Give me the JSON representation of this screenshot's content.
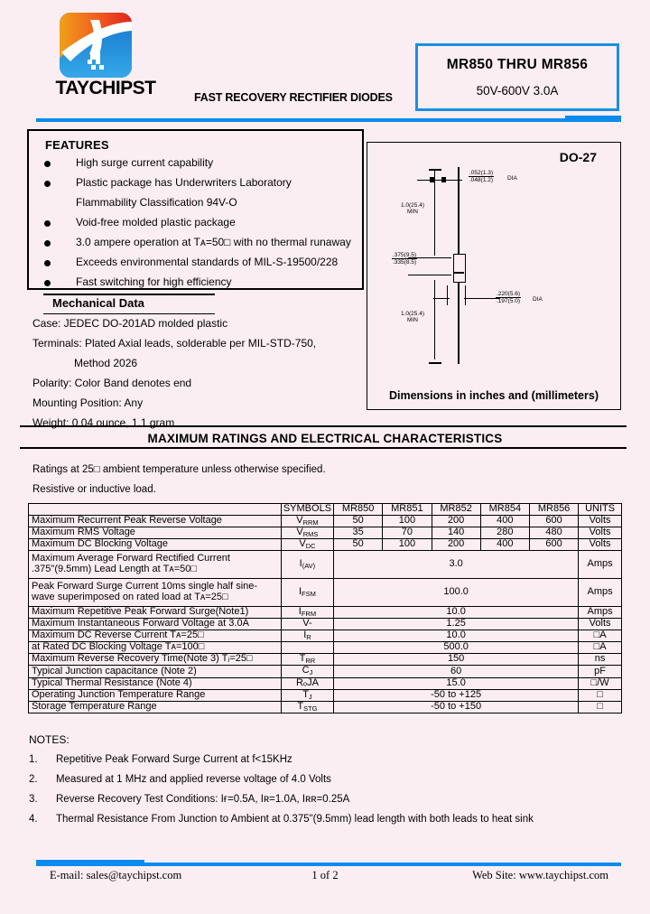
{
  "header": {
    "company": "TAYCHIPST",
    "tagline": "FAST RECOVERY RECTIFIER DIODES",
    "part_range": "MR850  THRU  MR856",
    "ratings_summary": "50V-600V    3.0A"
  },
  "features": {
    "title": "FEATURES",
    "items": [
      "High surge current capability",
      "Plastic package has Underwriters Laboratory",
      "Flammability Classification 94V-O",
      "Void-free molded plastic package",
      "3.0 ampere operation at Tᴀ=50□ with no thermal runaway",
      "Exceeds environmental standards of MIL-S-19500/228",
      "Fast switching for high efficiency"
    ]
  },
  "mechanical": {
    "title": "Mechanical Data",
    "lines": [
      "Case: JEDEC DO-201AD molded plastic",
      "Terminals: Plated Axial leads, solderable per MIL-STD-750,",
      "Method 2026",
      "Polarity: Color Band denotes end",
      "Mounting Position: Any",
      "Weight: 0.04 ounce, 1.1 gram"
    ]
  },
  "diagram": {
    "package": "DO-27",
    "caption": "Dimensions in inches and (millimeters)",
    "lead_dia_top_num": ".052(1.3)",
    "lead_dia_top_den": ".048(1.2)",
    "lead_dia_top_label": "DIA",
    "length_top_value": "1.0(25.4)",
    "length_top_min": "MIN",
    "body_len_num": ".375(9.5)",
    "body_len_den": ".335(8.5)",
    "body_dia_num": ".220(5.6)",
    "body_dia_den": ".197(5.0)",
    "body_dia_label": "DIA",
    "length_bot_value": "1.0(25.4)",
    "length_bot_min": "MIN"
  },
  "section": {
    "title": "MAXIMUM RATINGS AND ELECTRICAL CHARACTERISTICS",
    "note_ratings": "Ratings at 25□ ambient temperature unless otherwise specified.",
    "note_load": "Resistive or inductive load."
  },
  "table": {
    "headers": [
      "",
      "SYMBOLS",
      "MR850",
      "MR851",
      "MR852",
      "MR854",
      "MR856",
      "UNITS"
    ],
    "rows": [
      {
        "desc": "Maximum Recurrent Peak Reverse Voltage",
        "sym": "V",
        "sub": "RRM",
        "values": [
          "50",
          "100",
          "200",
          "400",
          "600"
        ],
        "unit": "Volts"
      },
      {
        "desc": "Maximum RMS Voltage",
        "sym": "V",
        "sub": "RMS",
        "values": [
          "35",
          "70",
          "140",
          "280",
          "480"
        ],
        "unit": "Volts"
      },
      {
        "desc": "Maximum DC Blocking Voltage",
        "sym": "V",
        "sub": "DC",
        "values": [
          "50",
          "100",
          "200",
          "400",
          "600"
        ],
        "unit": "Volts"
      },
      {
        "desc": "Maximum Average Forward Rectified Current",
        "desc2": ".375\"(9.5mm) Lead Length at Tᴀ=50□",
        "sym": "I",
        "sub": "(AV)",
        "span": "3.0",
        "unit": "Amps"
      },
      {
        "desc": "Peak Forward Surge Current 10ms single half sine-",
        "desc2": "wave superimposed on rated load at Tᴀ=25□",
        "sym": "I",
        "sub": "FSM",
        "span": "100.0",
        "unit": "Amps"
      },
      {
        "desc": "Maximum Repetitive Peak Forward Surge(Note1)",
        "sym": "I",
        "sub": "FRM",
        "span": "10.0",
        "unit": "Amps"
      },
      {
        "desc": "Maximum Instantaneous Forward Voltage at 3.0A",
        "sym": "V-",
        "sub": "",
        "span": "1.25",
        "unit": "Volts"
      },
      {
        "desc": "Maximum DC Reverse Current  Tᴀ=25□",
        "sym": "I",
        "sub": "R",
        "span": "10.0",
        "unit": "□A"
      },
      {
        "desc": "at Rated DC Blocking Voltage Tᴀ=100□",
        "sym": "",
        "sub": "",
        "span": "500.0",
        "unit": "□A"
      },
      {
        "desc": "Maximum Reverse Recovery Time(Note 3) Tⱼ=25□",
        "sym": "T",
        "sub": "RR",
        "span": "150",
        "unit": "ns"
      },
      {
        "desc": "Typical Junction capacitance (Note 2)",
        "sym": "C",
        "sub": "J",
        "span": "60",
        "unit": "pF"
      },
      {
        "desc": "Typical Thermal Resistance (Note 4)",
        "sym": "RₒJA",
        "sub": "",
        "span": "15.0",
        "unit": "□/W"
      },
      {
        "desc": "Operating Junction Temperature Range",
        "sym": "T",
        "sub": "J",
        "span": "-50 to +125",
        "unit": "□"
      },
      {
        "desc": "Storage Temperature Range",
        "sym": "T",
        "sub": "STG",
        "span": "-50 to +150",
        "unit": "□"
      }
    ]
  },
  "notes": {
    "title": "NOTES:",
    "items": [
      {
        "num": "1.",
        "text": "Repetitive Peak Forward Surge Current at f<15KHz"
      },
      {
        "num": "2.",
        "text": "Measured at 1 MHz and applied reverse voltage of 4.0 Volts"
      },
      {
        "num": "3.",
        "text": "Reverse Recovery Test Conditions: Iғ=0.5A, Iʀ=1.0A, Iʀʀ=0.25A"
      },
      {
        "num": "4.",
        "text": "Thermal Resistance From Junction to Ambient at 0.375\"(9.5mm) lead length with both leads to heat sink"
      }
    ]
  },
  "footer": {
    "email": "E-mail: sales@taychipst.com",
    "page": "1  of  2",
    "website": "Web Site: www.taychipst.com"
  },
  "colors": {
    "background": "#fbeef3",
    "accent_blue": "#0b8bec",
    "logo_blue": "#1b8fe0",
    "logo_orange": "#ef5a1e",
    "text": "#000000"
  }
}
